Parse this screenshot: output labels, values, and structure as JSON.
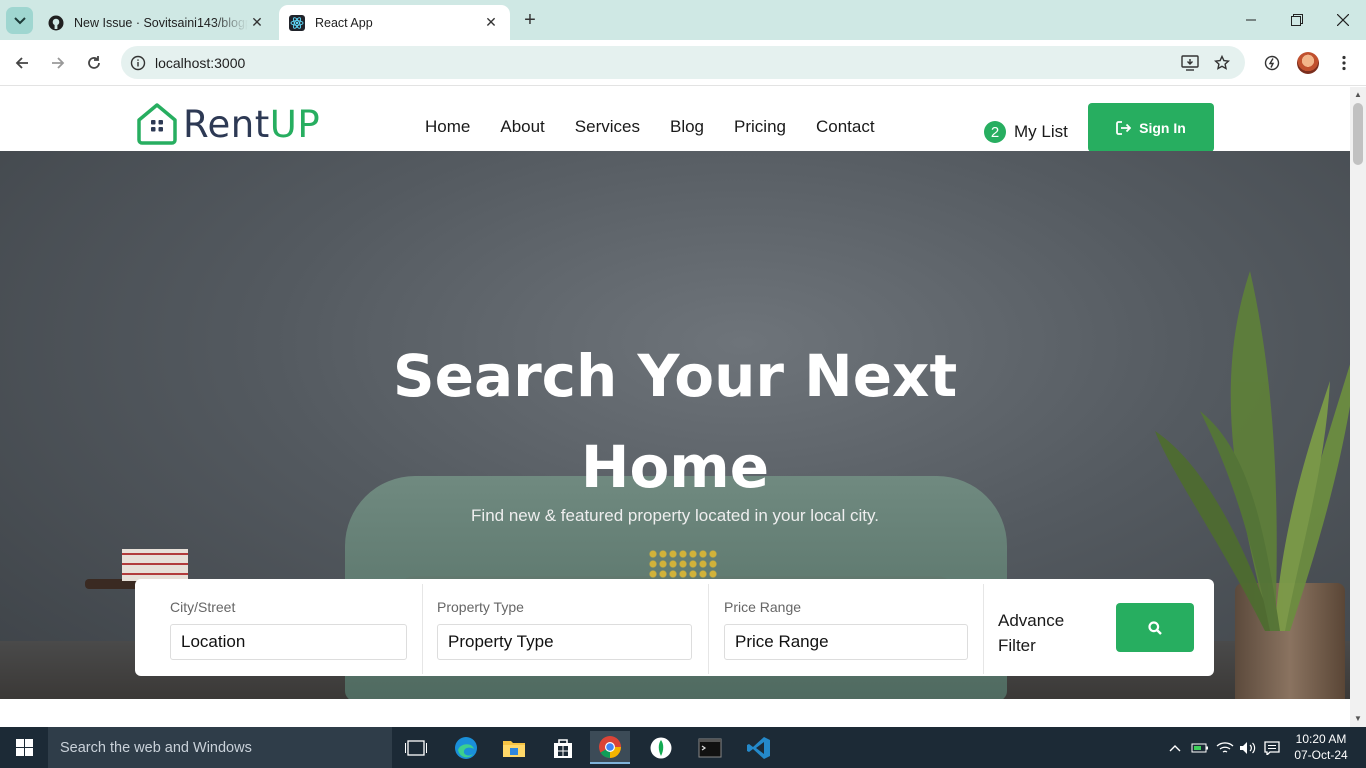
{
  "browser": {
    "tabs": [
      {
        "title": "New Issue · Sovitsaini143/blogp",
        "favicon": "github-icon",
        "active": false
      },
      {
        "title": "React App",
        "favicon": "react-icon",
        "active": true
      }
    ],
    "url": "localhost:3000"
  },
  "site": {
    "logo": {
      "part1": "Rent",
      "part2": "UP"
    },
    "nav": [
      "Home",
      "About",
      "Services",
      "Blog",
      "Pricing",
      "Contact"
    ],
    "mylist": {
      "count": "2",
      "label": "My List"
    },
    "signin_label": "Sign In",
    "hero": {
      "title_line1": "Search Your Next",
      "title_line2": "Home",
      "subtitle": "Find new & featured property located in your local city."
    },
    "search": {
      "fields": [
        {
          "label": "City/Street",
          "value": "Location"
        },
        {
          "label": "Property Type",
          "value": "Property Type"
        },
        {
          "label": "Price Range",
          "value": "Price Range"
        }
      ],
      "advance_line1": "Advance",
      "advance_line2": "Filter"
    },
    "accent_color": "#27ae60"
  },
  "taskbar": {
    "search_placeholder": "Search the web and Windows",
    "time": "10:20 AM",
    "date": "07-Oct-24"
  }
}
